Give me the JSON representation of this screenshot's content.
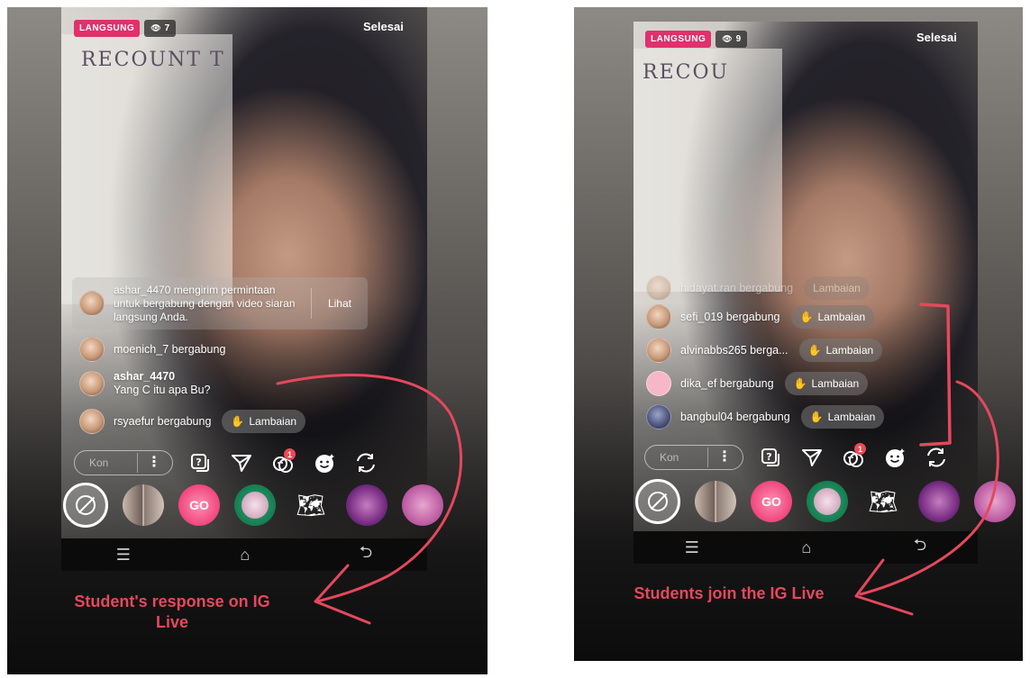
{
  "panels": [
    {
      "live_label": "LANGSUNG",
      "viewers": "7",
      "done_label": "Selesai",
      "notebook_text": "RECOUNT T",
      "join_request": {
        "text": "ashar_4470 mengirim permintaan untuk bergabung dengan video siaran langsung Anda.",
        "button": "Lihat"
      },
      "comments": [
        {
          "user": "moenich_7",
          "text": "moenich_7 bergabung"
        },
        {
          "user": "ashar_4470",
          "text": "Yang C itu apa Bu?"
        },
        {
          "user": "rsyaefur",
          "text": "rsyaefur bergabung",
          "wave": "Lambaian"
        }
      ],
      "comment_placeholder": "Kon",
      "notification_count": "1",
      "caption_line1": "Student's response on IG",
      "caption_line2": "Live"
    },
    {
      "live_label": "LANGSUNG",
      "viewers": "9",
      "done_label": "Selesai",
      "notebook_text": "RECOU",
      "faded_row": "hidayat.ran bergabung",
      "faded_wave": "Lambaian",
      "joins": [
        {
          "text": "sefi_019 bergabung",
          "wave": "Lambaian"
        },
        {
          "text": "alvinabbs265 berga...",
          "wave": "Lambaian"
        },
        {
          "text": "dika_ef bergabung",
          "wave": "Lambaian"
        },
        {
          "text": "bangbul04 bergabung",
          "wave": "Lambaian"
        }
      ],
      "comment_placeholder": "Kon",
      "notification_count": "1",
      "caption": "Students join the IG Live"
    }
  ],
  "colors": {
    "live": "#e1306c",
    "annotation": "#e5485d",
    "notification": "#ed4956"
  }
}
